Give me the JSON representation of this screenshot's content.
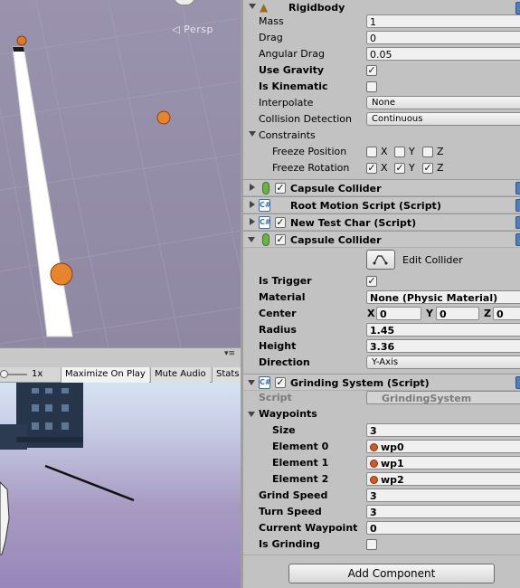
{
  "scene": {
    "persp_label": "◁ Persp"
  },
  "game": {
    "scale_label": "1x",
    "maximize_label": "Maximize On Play",
    "mute_label": "Mute Audio",
    "stats_label": "Stats",
    "menu_glyph": "▾≡"
  },
  "rigidbody": {
    "title": "Rigidbody",
    "mass_label": "Mass",
    "mass": "1",
    "drag_label": "Drag",
    "drag": "0",
    "angular_drag_label": "Angular Drag",
    "angular_drag": "0.05",
    "use_gravity_label": "Use Gravity",
    "use_gravity": true,
    "is_kinematic_label": "Is Kinematic",
    "is_kinematic": false,
    "interpolate_label": "Interpolate",
    "interpolate": "None",
    "collision_label": "Collision Detection",
    "collision": "Continuous",
    "constraints_label": "Constraints",
    "freeze_position_label": "Freeze Position",
    "freeze_rotation_label": "Freeze Rotation",
    "axis_x": "X",
    "axis_y": "Y",
    "axis_z": "Z"
  },
  "components": {
    "capsule1": "Capsule Collider",
    "root_motion": "Root Motion Script (Script)",
    "new_test_char": "New Test Char (Script)",
    "capsule2": "Capsule Collider"
  },
  "capsule_collider": {
    "edit_collider_label": "Edit Collider",
    "is_trigger_label": "Is Trigger",
    "is_trigger": true,
    "material_label": "Material",
    "material": "None (Physic Material)",
    "center_label": "Center",
    "center_x": "0",
    "center_y": "0",
    "center_z": "0",
    "axis_x": "X",
    "axis_y": "Y",
    "axis_z": "Z",
    "radius_label": "Radius",
    "radius": "1.45",
    "height_label": "Height",
    "height": "3.36",
    "direction_label": "Direction",
    "direction": "Y-Axis"
  },
  "grinding_system": {
    "title": "Grinding System (Script)",
    "script_label": "Script",
    "script": "GrindingSystem",
    "waypoints_label": "Waypoints",
    "size_label": "Size",
    "size": "3",
    "element0_label": "Element 0",
    "element0": "wp0",
    "element1_label": "Element 1",
    "element1": "wp1",
    "element2_label": "Element 2",
    "element2": "wp2",
    "grind_speed_label": "Grind Speed",
    "grind_speed": "3",
    "turn_speed_label": "Turn Speed",
    "turn_speed": "3",
    "current_waypoint_label": "Current Waypoint",
    "current_waypoint": "0",
    "is_grinding_label": "Is Grinding",
    "is_grinding": false
  },
  "add_component_label": "Add Component",
  "icons": {
    "check": "✓",
    "script": "C#"
  }
}
